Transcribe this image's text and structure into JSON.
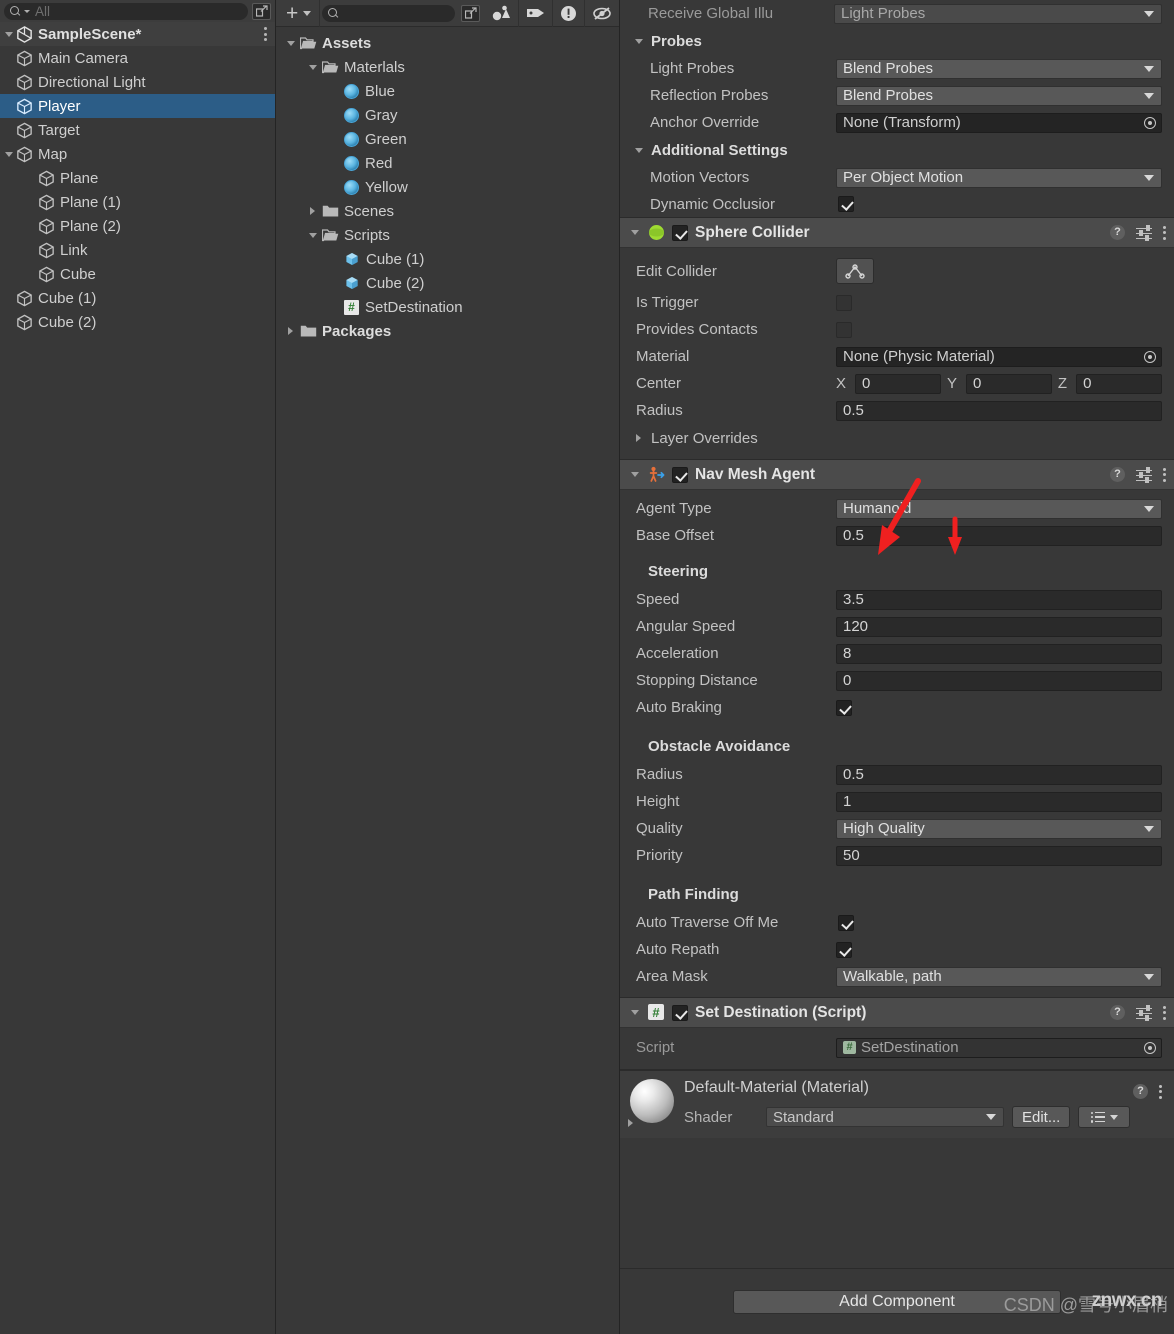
{
  "hierarchy": {
    "search": {
      "placeholder": "All",
      "value": ""
    },
    "scene": {
      "label": "SampleScene*"
    },
    "items": [
      {
        "label": "Main Camera",
        "depth": 1,
        "expand": "none",
        "selected": false
      },
      {
        "label": "Directional Light",
        "depth": 1,
        "expand": "none",
        "selected": false
      },
      {
        "label": "Player",
        "depth": 1,
        "expand": "none",
        "selected": true
      },
      {
        "label": "Target",
        "depth": 1,
        "expand": "none",
        "selected": false
      },
      {
        "label": "Map",
        "depth": 1,
        "expand": "down",
        "selected": false
      },
      {
        "label": "Plane",
        "depth": 2,
        "expand": "none",
        "selected": false
      },
      {
        "label": "Plane (1)",
        "depth": 2,
        "expand": "none",
        "selected": false
      },
      {
        "label": "Plane (2)",
        "depth": 2,
        "expand": "none",
        "selected": false
      },
      {
        "label": "Link",
        "depth": 2,
        "expand": "none",
        "selected": false
      },
      {
        "label": "Cube",
        "depth": 2,
        "expand": "none",
        "selected": false
      },
      {
        "label": "Cube (1)",
        "depth": 1,
        "expand": "none",
        "selected": false
      },
      {
        "label": "Cube (2)",
        "depth": 1,
        "expand": "none",
        "selected": false
      }
    ]
  },
  "project": {
    "toolbar": {
      "create_label": "+",
      "search_placeholder": "",
      "icons": [
        "plus-icon",
        "chevron-down-icon",
        "search-icon",
        "open-in-new-icon",
        "favorite-icon",
        "label-icon",
        "warning-icon",
        "visibility-off-icon"
      ]
    },
    "items": [
      {
        "label": "Assets",
        "depth": 0,
        "expand": "down",
        "icon": "folder-open-icon",
        "bold": true
      },
      {
        "label": "Materlals",
        "depth": 1,
        "expand": "down",
        "icon": "folder-open-icon",
        "bold": false
      },
      {
        "label": "Blue",
        "depth": 2,
        "expand": "none",
        "icon": "material-ball-icon",
        "bold": false
      },
      {
        "label": "Gray",
        "depth": 2,
        "expand": "none",
        "icon": "material-ball-icon",
        "bold": false
      },
      {
        "label": "Green",
        "depth": 2,
        "expand": "none",
        "icon": "material-ball-icon",
        "bold": false
      },
      {
        "label": "Red",
        "depth": 2,
        "expand": "none",
        "icon": "material-ball-icon",
        "bold": false
      },
      {
        "label": "Yellow",
        "depth": 2,
        "expand": "none",
        "icon": "material-ball-icon",
        "bold": false
      },
      {
        "label": "Scenes",
        "depth": 1,
        "expand": "right",
        "icon": "folder-icon",
        "bold": false
      },
      {
        "label": "Scripts",
        "depth": 1,
        "expand": "down",
        "icon": "folder-open-icon",
        "bold": false
      },
      {
        "label": "Cube (1)",
        "depth": 2,
        "expand": "none",
        "icon": "prefab-cube-icon",
        "bold": false
      },
      {
        "label": "Cube (2)",
        "depth": 2,
        "expand": "none",
        "icon": "prefab-cube-icon",
        "bold": false
      },
      {
        "label": "SetDestination",
        "depth": 2,
        "expand": "none",
        "icon": "cs-script-icon",
        "bold": false
      },
      {
        "label": "Packages",
        "depth": 0,
        "expand": "right",
        "icon": "folder-icon",
        "bold": true
      }
    ]
  },
  "inspector": {
    "renderer_tail": {
      "receive_gi_label": "Receive Global Illu",
      "receive_gi_value": "Light Probes",
      "probes_header": "Probes",
      "light_probes_label": "Light Probes",
      "light_probes_value": "Blend Probes",
      "reflection_probes_label": "Reflection Probes",
      "reflection_probes_value": "Blend Probes",
      "anchor_override_label": "Anchor Override",
      "anchor_override_value": "None (Transform)",
      "additional_header": "Additional Settings",
      "motion_vectors_label": "Motion Vectors",
      "motion_vectors_value": "Per Object Motion",
      "dynamic_occlusion_label": "Dynamic Occlusior",
      "dynamic_occlusion_checked": true
    },
    "sphere_collider": {
      "title": "Sphere Collider",
      "enabled": true,
      "edit_collider_label": "Edit Collider",
      "is_trigger_label": "Is Trigger",
      "is_trigger_checked": false,
      "provides_contacts_label": "Provides Contacts",
      "provides_contacts_checked": false,
      "material_label": "Material",
      "material_value": "None (Physic Material)",
      "center_label": "Center",
      "center_x_axis": "X",
      "center_x": "0",
      "center_y_axis": "Y",
      "center_y": "0",
      "center_z_axis": "Z",
      "center_z": "0",
      "radius_label": "Radius",
      "radius_value": "0.5",
      "layer_overrides_label": "Layer Overrides"
    },
    "nav_mesh_agent": {
      "title": "Nav Mesh Agent",
      "enabled": true,
      "agent_type_label": "Agent Type",
      "agent_type_value": "Humanoid",
      "base_offset_label": "Base Offset",
      "base_offset_value": "0.5",
      "steering_header": "Steering",
      "speed_label": "Speed",
      "speed_value": "3.5",
      "angular_speed_label": "Angular Speed",
      "angular_speed_value": "120",
      "acceleration_label": "Acceleration",
      "acceleration_value": "8",
      "stopping_distance_label": "Stopping Distance",
      "stopping_distance_value": "0",
      "auto_braking_label": "Auto Braking",
      "auto_braking_checked": true,
      "obstacle_header": "Obstacle Avoidance",
      "oa_radius_label": "Radius",
      "oa_radius_value": "0.5",
      "oa_height_label": "Height",
      "oa_height_value": "1",
      "oa_quality_label": "Quality",
      "oa_quality_value": "High Quality",
      "oa_priority_label": "Priority",
      "oa_priority_value": "50",
      "pathfinding_header": "Path Finding",
      "auto_traverse_label": "Auto Traverse Off Me",
      "auto_traverse_checked": true,
      "auto_repath_label": "Auto Repath",
      "auto_repath_checked": true,
      "area_mask_label": "Area Mask",
      "area_mask_value": "Walkable, path"
    },
    "set_destination": {
      "title": "Set Destination (Script)",
      "enabled": true,
      "script_label": "Script",
      "script_value": "SetDestination"
    },
    "material_card": {
      "name": "Default-Material (Material)",
      "shader_label": "Shader",
      "shader_value": "Standard",
      "edit_label": "Edit...",
      "preset_icon": "preset-list-icon"
    },
    "footer": {
      "add_component_label": "Add Component",
      "watermark": "CSDN @雪号小眉梢",
      "watermark_overlay": "znwx.cn"
    },
    "annotations": {
      "arrow_color": "#ef2020",
      "count": 2
    }
  }
}
